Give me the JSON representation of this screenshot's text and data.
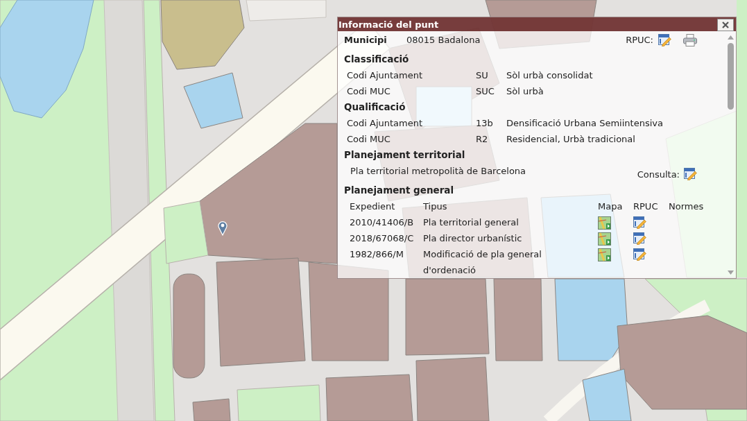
{
  "popup": {
    "title": "Informació del punt"
  },
  "municipality": {
    "label": "Municipi",
    "value": "08015 Badalona",
    "rpuc_label": "RPUC:"
  },
  "sections": [
    {
      "kind": "codes",
      "title": "Classificació",
      "rows": [
        {
          "label": "Codi Ajuntament",
          "code": "SU",
          "description": "Sòl urbà consolidat"
        },
        {
          "label": "Codi MUC",
          "code": "SUC",
          "description": "Sòl urbà"
        }
      ]
    },
    {
      "kind": "codes",
      "title": "Qualificació",
      "rows": [
        {
          "label": "Codi Ajuntament",
          "code": "13b",
          "description": "Densificació Urbana Semiintensiva"
        },
        {
          "label": "Codi MUC",
          "code": "R2",
          "description": "Residencial, Urbà tradicional"
        }
      ]
    },
    {
      "kind": "plan",
      "title": "Planejament territorial",
      "text": "Pla territorial metropolità de Barcelona",
      "link_label": "Consulta:"
    },
    {
      "kind": "table",
      "title": "Planejament general",
      "columns": [
        "Expedient",
        "Tipus",
        "Mapa",
        "RPUC",
        "Normes"
      ],
      "rows": [
        {
          "expedient": "2010/41406/B",
          "type": "Pla territorial general"
        },
        {
          "expedient": "2018/67068/C",
          "type": "Pla director urbanístic"
        },
        {
          "expedient": "1982/866/M",
          "type": "Modificació de pla general d'ordenació"
        }
      ]
    }
  ]
}
